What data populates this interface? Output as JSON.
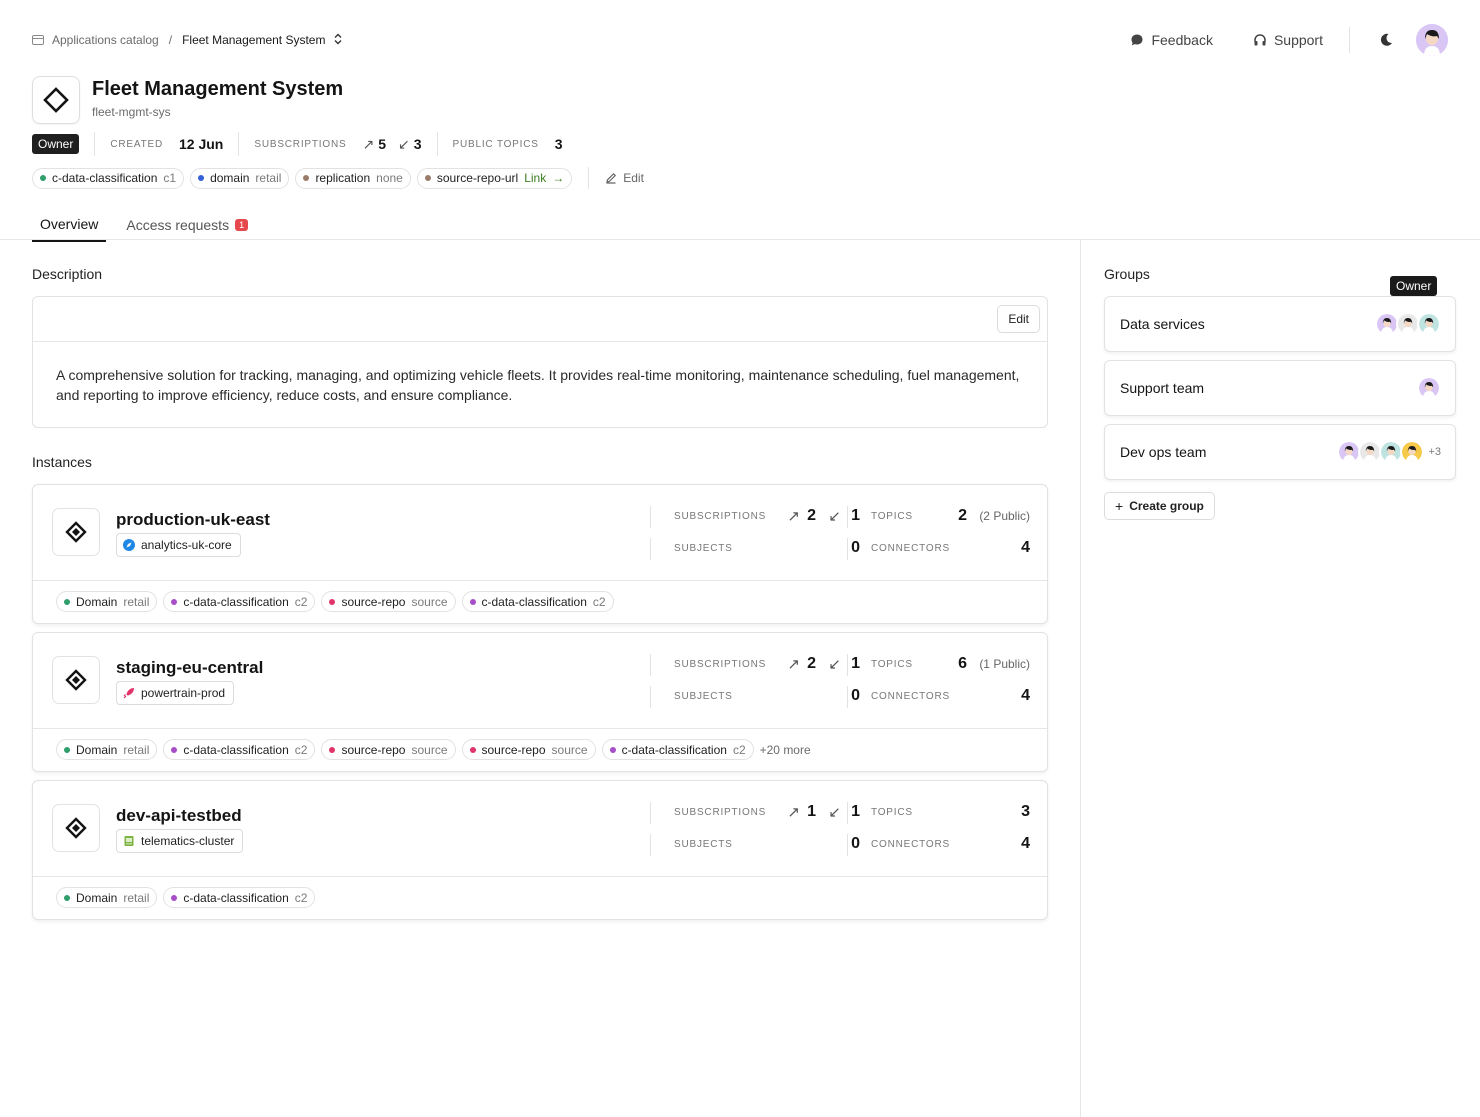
{
  "breadcrumb": {
    "root": "Applications catalog",
    "separator": "/",
    "current": "Fleet Management System"
  },
  "topnav": {
    "feedback": "Feedback",
    "support": "Support"
  },
  "app": {
    "title": "Fleet Management System",
    "slug": "fleet-mgmt-sys",
    "role_badge": "Owner",
    "created_label": "CREATED",
    "created_value": "12 Jun",
    "subscriptions_label": "SUBSCRIPTIONS",
    "subscriptions_out": "5",
    "subscriptions_in": "3",
    "public_topics_label": "PUBLIC TOPICS",
    "public_topics_value": "3",
    "tags": [
      {
        "key": "c-data-classification",
        "value": "c1",
        "color": "#2e9e6a"
      },
      {
        "key": "domain",
        "value": "retail",
        "color": "#3461d9"
      },
      {
        "key": "replication",
        "value": "none",
        "color": "#9a7b6a"
      },
      {
        "key": "source-repo-url",
        "value": "Link",
        "color": "#9a7b6a"
      }
    ],
    "edit_label": "Edit"
  },
  "tabs": [
    {
      "label": "Overview",
      "active": true
    },
    {
      "label": "Access requests",
      "badge": "1"
    }
  ],
  "description": {
    "title": "Description",
    "edit_label": "Edit",
    "text": "A comprehensive solution for tracking, managing, and optimizing vehicle fleets. It provides real-time monitoring, maintenance scheduling, fuel management, and reporting to improve efficiency, reduce costs, and ensure compliance."
  },
  "instances_title": "Instances",
  "instance_labels": {
    "subscriptions": "SUBSCRIPTIONS",
    "subjects": "SUBJECTS",
    "topics": "TOPICS",
    "connectors": "CONNECTORS"
  },
  "instances": [
    {
      "name": "production-uk-east",
      "cluster": "analytics-uk-core",
      "cluster_icon": "compass-icon",
      "subs_out": "2",
      "subs_in": "1",
      "topics": "2",
      "topics_public": "(2 Public)",
      "subjects": "0",
      "connectors": "4",
      "tags": [
        {
          "key": "Domain",
          "value": "retail",
          "color": "#2e9e6a"
        },
        {
          "key": "c-data-classification",
          "value": "c2",
          "color": "#a64fc9"
        },
        {
          "key": "source-repo",
          "value": "source",
          "color": "#e0346a"
        },
        {
          "key": "c-data-classification",
          "value": "c2",
          "color": "#a64fc9"
        }
      ],
      "more": ""
    },
    {
      "name": "staging-eu-central",
      "cluster": "powertrain-prod",
      "cluster_icon": "rocket-icon",
      "subs_out": "2",
      "subs_in": "1",
      "topics": "6",
      "topics_public": "(1 Public)",
      "subjects": "0",
      "connectors": "4",
      "tags": [
        {
          "key": "Domain",
          "value": "retail",
          "color": "#2e9e6a"
        },
        {
          "key": "c-data-classification",
          "value": "c2",
          "color": "#a64fc9"
        },
        {
          "key": "source-repo",
          "value": "source",
          "color": "#e0346a"
        },
        {
          "key": "source-repo",
          "value": "source",
          "color": "#e0346a"
        },
        {
          "key": "c-data-classification",
          "value": "c2",
          "color": "#a64fc9"
        }
      ],
      "more": "+20 more"
    },
    {
      "name": "dev-api-testbed",
      "cluster": "telematics-cluster",
      "cluster_icon": "server-icon",
      "subs_out": "1",
      "subs_in": "1",
      "topics": "3",
      "topics_public": "",
      "subjects": "0",
      "connectors": "4",
      "tags": [
        {
          "key": "Domain",
          "value": "retail",
          "color": "#2e9e6a"
        },
        {
          "key": "c-data-classification",
          "value": "c2",
          "color": "#a64fc9"
        }
      ],
      "more": ""
    }
  ],
  "groups_title": "Groups",
  "groups": [
    {
      "name": "Data services",
      "avatars": [
        "#d9c6f5",
        "#e8e8e8",
        "#bfe3e0"
      ],
      "more": ""
    },
    {
      "name": "Support team",
      "avatars": [
        "#d9c6f5"
      ],
      "more": ""
    },
    {
      "name": "Dev ops team",
      "avatars": [
        "#d9c6f5",
        "#e8e8e8",
        "#bfe3e0",
        "#f7c948"
      ],
      "more": "+3"
    }
  ],
  "tooltip": "Owner",
  "create_group_label": "Create group"
}
